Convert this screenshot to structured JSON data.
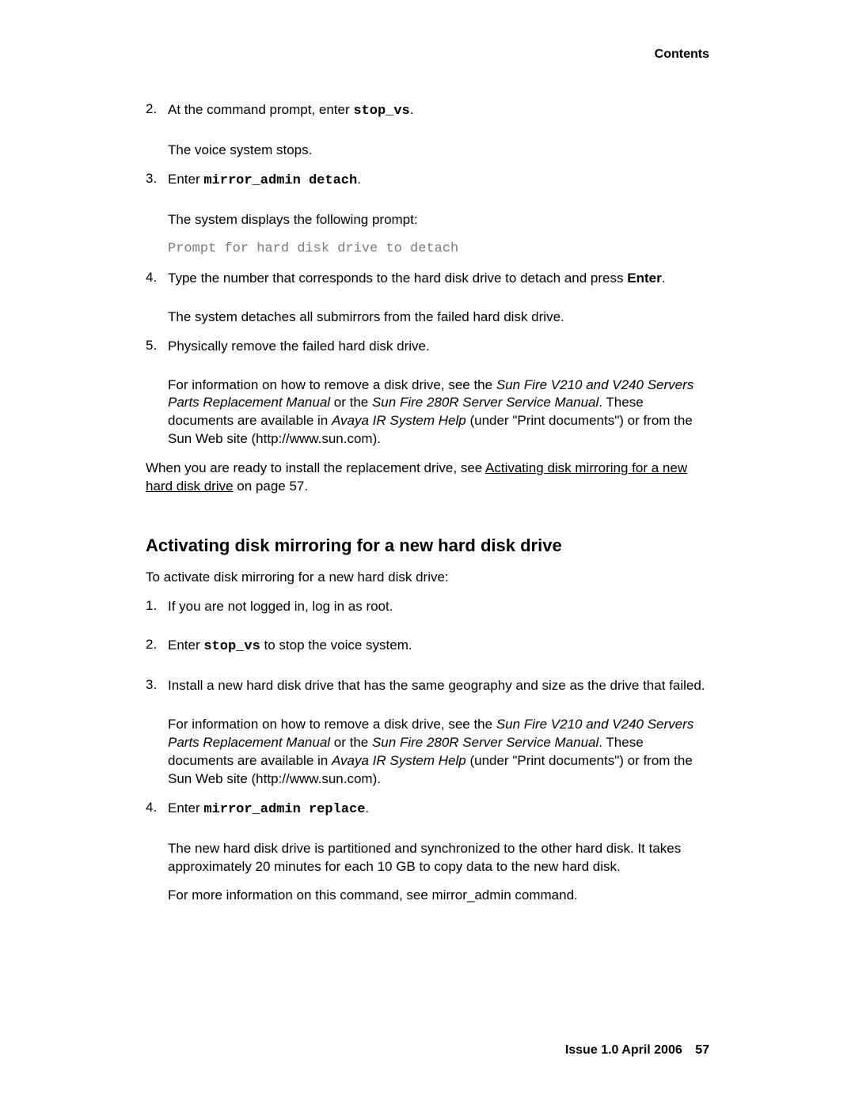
{
  "header": {
    "label": "Contents"
  },
  "list1": {
    "items": [
      {
        "num": "2.",
        "lead": "At the command prompt, enter ",
        "cmd": "stop_vs",
        "after_cmd": ".",
        "follow_para": "The voice system stops."
      },
      {
        "num": "3.",
        "lead": "Enter ",
        "cmd": "mirror_admin detach",
        "after_cmd": ".",
        "follow_para": "The system displays the following prompt:",
        "prompt_text": "Prompt for hard disk drive to detach"
      },
      {
        "num": "4.",
        "lead": "Type the number that corresponds to the hard disk drive to detach and press ",
        "bold_word": "Enter",
        "after_bold": ".",
        "follow_para": "The system detaches all submirrors from the failed hard disk drive."
      },
      {
        "num": "5.",
        "lead": "Physically remove the failed hard disk drive.",
        "ref_intro": "For information on how to remove a disk drive, see the ",
        "ref_italic1": "Sun Fire V210 and V240 Servers Parts Replacement Manual",
        "ref_mid": " or the ",
        "ref_italic2": "Sun Fire 280R Server Service Manual",
        "ref_post": ". These documents are available in ",
        "ref_italic3": "Avaya IR System Help",
        "ref_tail": " (under \"Print documents\") or from the Sun Web site (http://www.sun.com)."
      }
    ]
  },
  "closing": {
    "text_before": "When you are ready to install the replacement drive, see ",
    "link_text": "Activating disk mirroring for a new hard disk drive",
    "text_after": " on page 57."
  },
  "section2": {
    "heading": "Activating disk mirroring for a new hard disk drive",
    "intro": "To activate disk mirroring for a new hard disk drive:",
    "items": [
      {
        "num": "1.",
        "lead": "If you are not logged in, log in as root."
      },
      {
        "num": "2.",
        "lead": "Enter ",
        "cmd": "stop_vs",
        "after_cmd": " to stop the voice system."
      },
      {
        "num": "3.",
        "lead": "Install a new hard disk drive that has the same geography and size as the drive that failed.",
        "ref_intro": "For information on how to remove a disk drive, see the ",
        "ref_italic1": "Sun Fire V210 and V240 Servers Parts Replacement Manual",
        "ref_mid": " or the ",
        "ref_italic2": "Sun Fire 280R Server Service Manual",
        "ref_post": ". These documents are available in ",
        "ref_italic3": "Avaya IR System Help",
        "ref_tail": " (under \"Print documents\") or from the Sun Web site (http://www.sun.com)."
      },
      {
        "num": "4.",
        "lead": "Enter ",
        "cmd": "mirror_admin replace",
        "after_cmd": ".",
        "follow_para": "The new hard disk drive is partitioned and synchronized to the other hard disk. It takes approximately 20 minutes for each 10 GB to copy data to the new hard disk.",
        "extra_para": "For more information on this command, see mirror_admin command."
      }
    ]
  },
  "footer": {
    "issue": "Issue 1.0   April 2006",
    "page": "57"
  }
}
